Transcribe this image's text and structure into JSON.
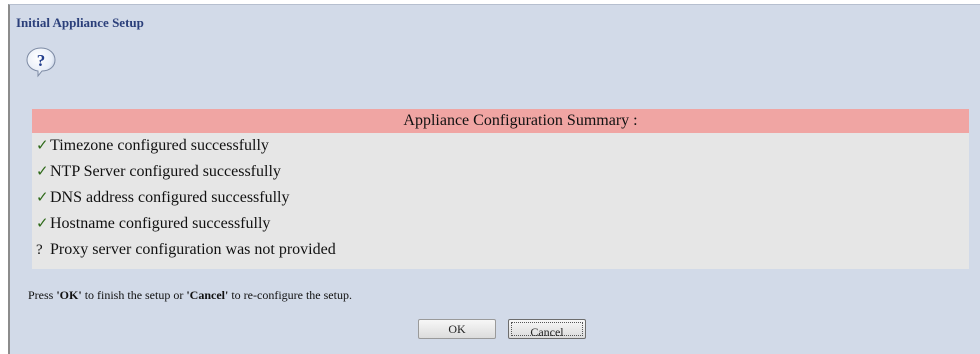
{
  "window": {
    "title": "Initial Appliance Setup"
  },
  "icon": {
    "name": "question-icon",
    "glyph": "?"
  },
  "summary": {
    "header": "Appliance Configuration Summary :",
    "items": [
      {
        "mark": "✓",
        "status": "success",
        "text": "Timezone configured successfully"
      },
      {
        "mark": "✓",
        "status": "success",
        "text": "NTP Server configured successfully"
      },
      {
        "mark": "✓",
        "status": "success",
        "text": "DNS address configured successfully"
      },
      {
        "mark": "✓",
        "status": "success",
        "text": "Hostname configured successfully"
      },
      {
        "mark": "?",
        "status": "not-provided",
        "text": "Proxy server configuration was not provided"
      }
    ]
  },
  "instruction": {
    "prefix": "Press ",
    "ok_word": "'OK'",
    "middle": " to finish the setup or ",
    "cancel_word": "'Cancel'",
    "suffix": " to re-configure the setup."
  },
  "buttons": {
    "ok_label": "OK",
    "cancel_label": "Cancel"
  },
  "colors": {
    "background": "#d2dae8",
    "header_bg": "#f0a5a3",
    "summary_bg": "#e6e6e6",
    "title_color": "#2b3f7a",
    "check_color": "#2f6a1a"
  }
}
